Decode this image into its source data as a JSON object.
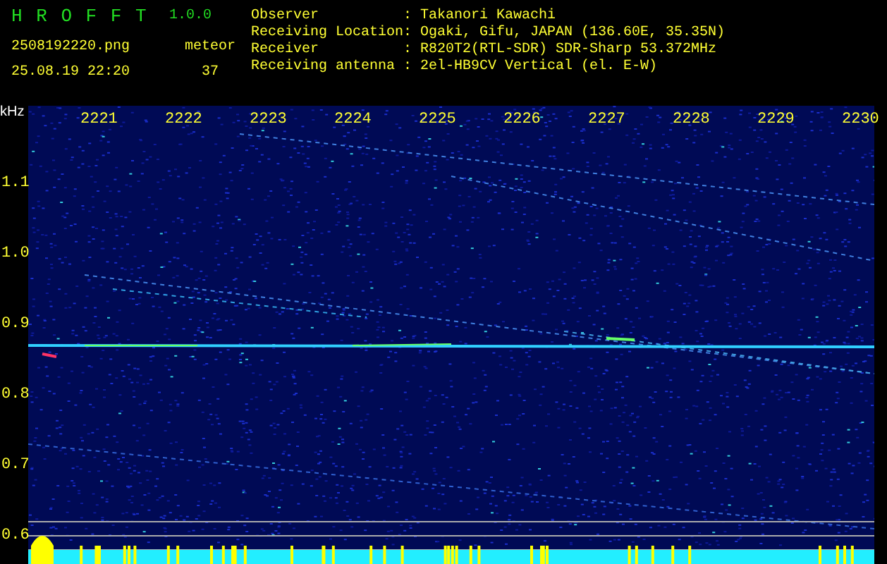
{
  "app": {
    "title": "H R O F F T",
    "version": "1.0.0"
  },
  "file": {
    "name": "2508192220.png",
    "datetime": "25.08.19 22:20"
  },
  "count": {
    "label": "meteor",
    "value": "37"
  },
  "info": [
    {
      "label": "Observer",
      "separator": ":",
      "value": "Takanori Kawachi"
    },
    {
      "label": "Receiving Location",
      "separator": ":",
      "value": "Ogaki, Gifu, JAPAN (136.60E, 35.35N)"
    },
    {
      "label": "Receiver",
      "separator": ":",
      "value": "R820T2(RTL-SDR) SDR-Sharp 53.372MHz"
    },
    {
      "label": "Receiving antenna",
      "separator": ":",
      "value": "2el-HB9CV Vertical (el. E-W)"
    }
  ],
  "plot": {
    "unit": "kHz",
    "freq_ticks": [
      "1.1",
      "1.0",
      "0.9",
      "0.8",
      "0.7",
      "0.6"
    ],
    "time_ticks": [
      "2221",
      "2222",
      "2223",
      "2224",
      "2225",
      "2226",
      "2227",
      "2228",
      "2229",
      "2230"
    ]
  }
}
